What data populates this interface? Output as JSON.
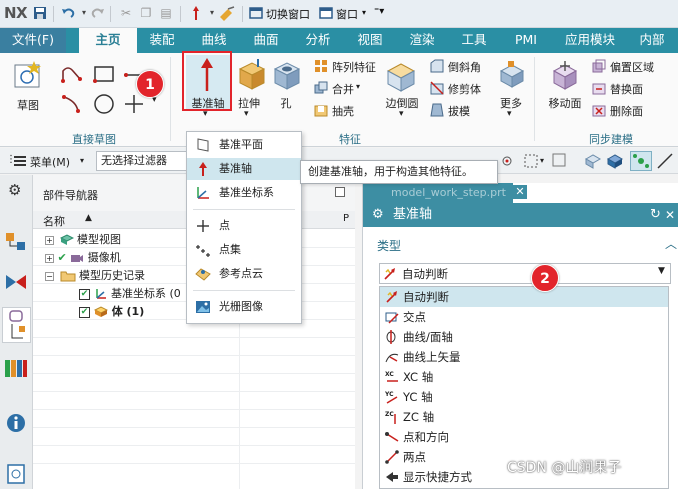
{
  "app": {
    "logo": "NX",
    "switch_window": "切换窗口",
    "window_menu": "窗口"
  },
  "tabs": [
    "文件(F)",
    "主页",
    "装配",
    "曲线",
    "曲面",
    "分析",
    "视图",
    "渲染",
    "工具",
    "PMI",
    "应用模块",
    "内部"
  ],
  "ribbon": {
    "sketch": "草图",
    "group_direct_sketch": "直接草图",
    "datum_axis": "基准轴",
    "extrude": "拉伸",
    "hole": "孔",
    "pattern_feature": "阵列特征",
    "unite": "合并",
    "shell": "抽壳",
    "edge_blend": "边倒圆",
    "chamfer": "倒斜角",
    "trim_body": "修剪体",
    "draft": "拔模",
    "more": "更多",
    "group_feature": "特征",
    "move_face": "移动面",
    "offset_region": "偏置区域",
    "replace_face": "替换面",
    "delete_face": "删除面",
    "group_sync": "同步建模"
  },
  "toolbar2": {
    "menu": "菜单(M)",
    "filter": "无选择过滤器"
  },
  "navigator": {
    "title": "部件导航器",
    "col_name": "名称",
    "col_p": "P",
    "items": [
      "模型视图",
      "摄像机",
      "模型历史记录",
      "基准坐标系 (0",
      "体 (1)"
    ]
  },
  "dropdown": {
    "items": [
      "基准平面",
      "基准轴",
      "基准坐标系",
      "点",
      "点集",
      "参考点云",
      "光栅图像"
    ]
  },
  "tooltip": "创建基准轴，用于构造其他特征。",
  "dialog": {
    "file_tab": "model_work_step.prt",
    "title": "基准轴",
    "section_type": "类型",
    "selected": "自动判断",
    "options": [
      "自动判断",
      "交点",
      "曲线/面轴",
      "曲线上矢量",
      "XC 轴",
      "YC 轴",
      "ZC 轴",
      "点和方向",
      "两点",
      "显示快捷方式"
    ]
  },
  "markers": [
    "1",
    "2"
  ],
  "watermark": "CSDN @山涧果子",
  "colors": {
    "ribbon_tab": "#2a8fa4",
    "dialog_header": "#3d8ea3",
    "highlight": "#cfe6ee",
    "marker": "#e2242b",
    "datum_axis_red": "#c8201c"
  }
}
